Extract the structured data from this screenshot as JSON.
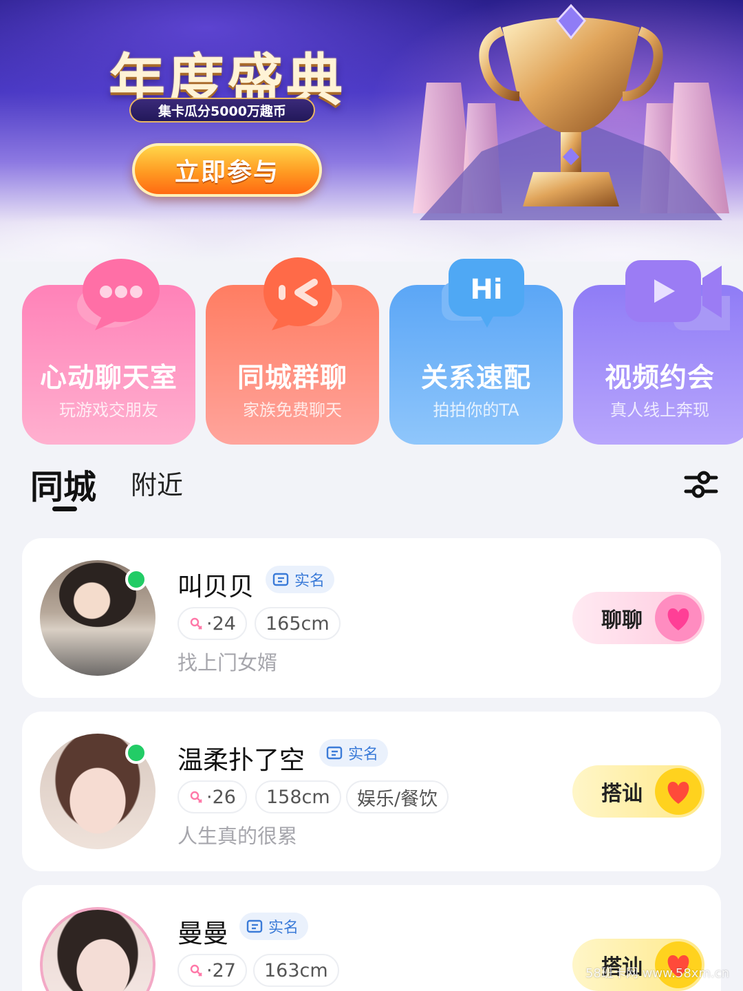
{
  "banner": {
    "title": "年度盛典",
    "subtitle": "集卡瓜分5000万趣币",
    "cta": "立即参与"
  },
  "features": [
    {
      "title": "心动聊天室",
      "subtitle": "玩游戏交朋友",
      "icon": "chat-bubble-icon"
    },
    {
      "title": "同城群聊",
      "subtitle": "家族免费聊天",
      "icon": "group-chat-icon"
    },
    {
      "title": "关系速配",
      "subtitle": "拍拍你的TA",
      "icon": "hi-bubble-icon"
    },
    {
      "title": "视频约会",
      "subtitle": "真人线上奔现",
      "icon": "video-camera-icon"
    }
  ],
  "tabs": {
    "active": "同城",
    "inactive": "附近"
  },
  "users": [
    {
      "name": "叫贝贝",
      "verified": "实名",
      "age": "·24",
      "height": "165cm",
      "bio": "找上门女婿",
      "online": true,
      "action": "聊聊"
    },
    {
      "name": "温柔扑了空",
      "verified": "实名",
      "age": "·26",
      "height": "158cm",
      "tag": "娱乐/餐饮",
      "bio": "人生真的很累",
      "online": true,
      "action": "搭讪"
    },
    {
      "name": "曼曼",
      "verified": "实名",
      "age": "·27",
      "height": "163cm",
      "action": "搭讪"
    }
  ],
  "watermark": "58班卡网 www.58xm.cn"
}
